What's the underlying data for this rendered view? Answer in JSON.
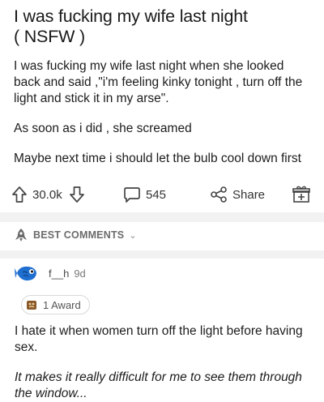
{
  "post": {
    "title_line1": "I was fucking my wife last night",
    "title_line2": "( NSFW )",
    "body": [
      "I was fucking my wife last night when she looked back and said ,\"i'm feeling kinky tonight , turn off the light and stick it in my arse\".",
      "As soon as i did , she screamed",
      "Maybe next time i should let the bulb cool down first"
    ]
  },
  "actions": {
    "upvote_icon": "upvote-arrow-icon",
    "score": "30.0k",
    "downvote_icon": "downvote-arrow-icon",
    "comment_icon": "comment-bubble-icon",
    "comments": "545",
    "share_icon": "share-icon",
    "share": "Share",
    "award_icon": "gift-award-icon"
  },
  "sort": {
    "icon": "rocket-icon",
    "label": "BEST COMMENTS",
    "chevron": "⌄"
  },
  "comment": {
    "user": "f__h",
    "age": "9d",
    "award": "1 Award",
    "text": "I hate it when women turn off the light before having sex.",
    "italic_text": "It makes it really difficult for me to see them through the window..."
  },
  "colors": {
    "accent_blue": "#1f6fd1",
    "divider": "#f2f2f2",
    "meta_text": "#7a7a7a"
  }
}
